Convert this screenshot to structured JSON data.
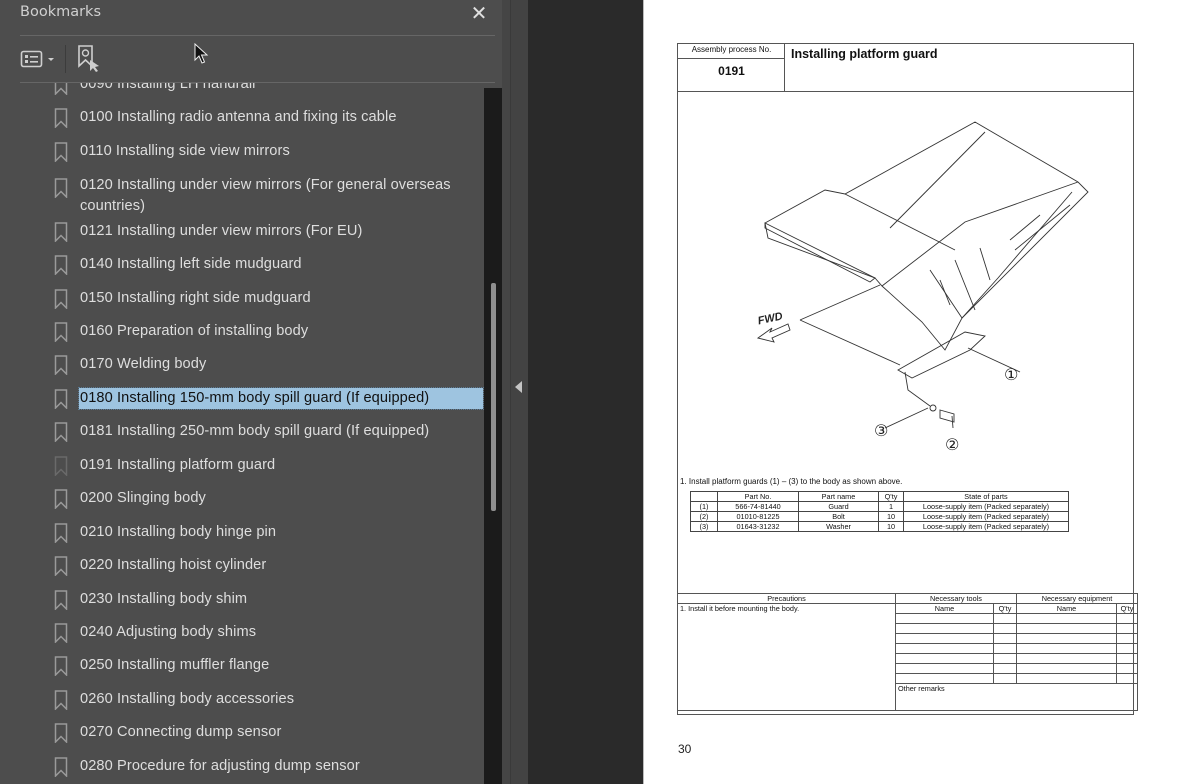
{
  "bookmarks_panel": {
    "title": "Bookmarks",
    "close_icon": "close-icon",
    "toolbar": {
      "options_icon": "list-options-icon",
      "find_icon": "find-current-bookmark-icon"
    },
    "items": [
      {
        "label": "0090 Installing LH handrail",
        "state": "clipped"
      },
      {
        "label": "0100 Installing radio antenna and fixing its cable"
      },
      {
        "label": "0110 Installing side view mirrors"
      },
      {
        "label": "0120 Installing under view mirrors (For general overseas countries)"
      },
      {
        "label": "0121 Installing under view mirrors (For EU)"
      },
      {
        "label": "0140 Installing left side mudguard"
      },
      {
        "label": "0150 Installing right side mudguard"
      },
      {
        "label": "0160 Preparation of installing body"
      },
      {
        "label": "0170 Welding body"
      },
      {
        "label": "0180 Installing 150-mm body spill guard (If equipped)",
        "state": "selected"
      },
      {
        "label": "0181 Installing 250-mm body spill guard (If equipped)"
      },
      {
        "label": "0191 Installing platform guard",
        "state": "current-page"
      },
      {
        "label": "0200 Slinging body"
      },
      {
        "label": "0210 Installing body hinge pin"
      },
      {
        "label": "0220 Installing hoist cylinder"
      },
      {
        "label": "0230 Installing body shim"
      },
      {
        "label": "0240 Adjusting body shims"
      },
      {
        "label": "0250 Installing muffler flange"
      },
      {
        "label": "0260 Installing body accessories"
      },
      {
        "label": "0270 Connecting dump sensor"
      },
      {
        "label": "0280 Procedure for adjusting dump sensor"
      }
    ],
    "selection_color": "#9ec4e0"
  },
  "document": {
    "process_no_label": "Assembly process No.",
    "process_no": "0191",
    "title": "Installing platform guard",
    "illustration": {
      "fwd_label": "FWD",
      "callouts": [
        "①",
        "②",
        "③"
      ]
    },
    "instruction": "1.  Install platform guards (1) – (3) to the body as shown above.",
    "parts_table": {
      "headers": [
        "",
        "Part No.",
        "Part name",
        "Q'ty",
        "State of parts"
      ],
      "rows": [
        [
          "(1)",
          "566-74-81440",
          "Guard",
          "1",
          "Loose-supply item (Packed separately)"
        ],
        [
          "(2)",
          "01010-81225",
          "Bolt",
          "10",
          "Loose-supply item (Packed separately)"
        ],
        [
          "(3)",
          "01643-31232",
          "Washer",
          "10",
          "Loose-supply item (Packed separately)"
        ]
      ]
    },
    "precautions": {
      "header": "Precautions",
      "text": "1.  Install it before mounting the body."
    },
    "tools": {
      "header": "Necessary tools",
      "name_col": "Name",
      "qty_col": "Q'ty"
    },
    "equipment": {
      "header": "Necessary equipment",
      "name_col": "Name",
      "qty_col": "Q'ty"
    },
    "other_remarks": "Other remarks",
    "page_number": "30"
  }
}
